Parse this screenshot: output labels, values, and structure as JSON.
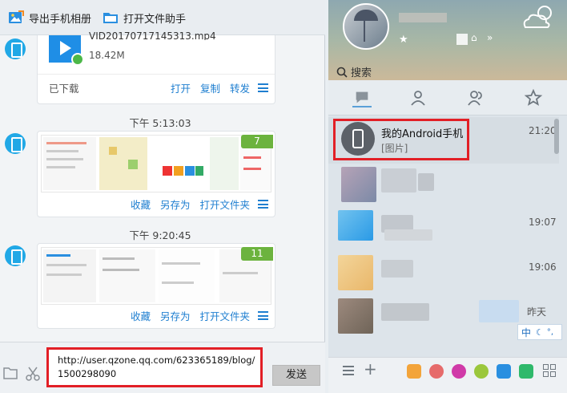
{
  "toolbar": {
    "export_album": "导出手机相册",
    "open_file_helper": "打开文件助手"
  },
  "messages": {
    "video": {
      "filename": "VID20170717145313.mp4",
      "size": "18.42M",
      "status": "已下载",
      "actions": [
        "打开",
        "复制",
        "转发"
      ]
    },
    "image1": {
      "time": "下午 5:13:03",
      "count": "7",
      "actions": [
        "收藏",
        "另存为",
        "打开文件夹"
      ]
    },
    "image2": {
      "time": "下午 9:20:45",
      "count": "11",
      "actions": [
        "收藏",
        "另存为",
        "打开文件夹"
      ]
    }
  },
  "composer": {
    "input_text": "http://user.qzone.qq.com/623365189/blog/1500298090",
    "send_label": "发送"
  },
  "qq_panel": {
    "search_placeholder": "搜索",
    "contacts": [
      {
        "name": "我的Android手机",
        "preview": "[图片]",
        "time": "21:20"
      },
      {
        "time": ""
      },
      {
        "time": "19:07"
      },
      {
        "time": "19:06"
      },
      {
        "time": "昨天"
      }
    ],
    "status_char": "中"
  },
  "colors": {
    "accent": "#1f7fd0",
    "highlight_red": "#e21f26",
    "badge_green": "#6cb33e",
    "phone_blue": "#21a8e6"
  }
}
